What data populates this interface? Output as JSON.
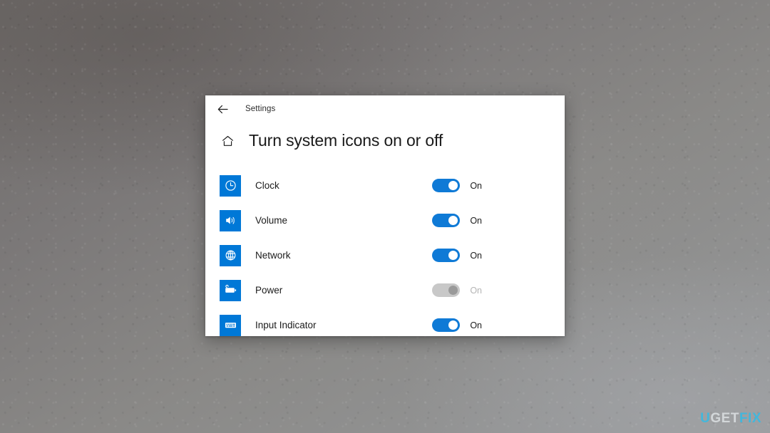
{
  "window": {
    "titlebar": {
      "back_icon": "back-arrow-icon",
      "app_name": "Settings"
    },
    "header": {
      "home_icon": "home-icon",
      "title": "Turn system icons on or off"
    },
    "rows": [
      {
        "icon": "clock-icon",
        "label": "Clock",
        "state": "On",
        "enabled": true
      },
      {
        "icon": "volume-speaker-icon",
        "label": "Volume",
        "state": "On",
        "enabled": true
      },
      {
        "icon": "network-globe-icon",
        "label": "Network",
        "state": "On",
        "enabled": true
      },
      {
        "icon": "power-battery-icon",
        "label": "Power",
        "state": "On",
        "enabled": false
      },
      {
        "icon": "keyboard-icon",
        "label": "Input Indicator",
        "state": "On",
        "enabled": true
      }
    ]
  },
  "watermark": {
    "part1": "U",
    "part2": "GET",
    "part3": "FIX"
  },
  "colors": {
    "accent": "#0078d7",
    "toggle_on": "#0f7ad6",
    "toggle_disabled": "#c8c8c8",
    "window_bg": "#ffffff",
    "text": "#1b1b1b",
    "text_disabled": "#b4b4b4",
    "watermark_accent": "#3cb9e0",
    "watermark_light": "#d8dcde"
  }
}
